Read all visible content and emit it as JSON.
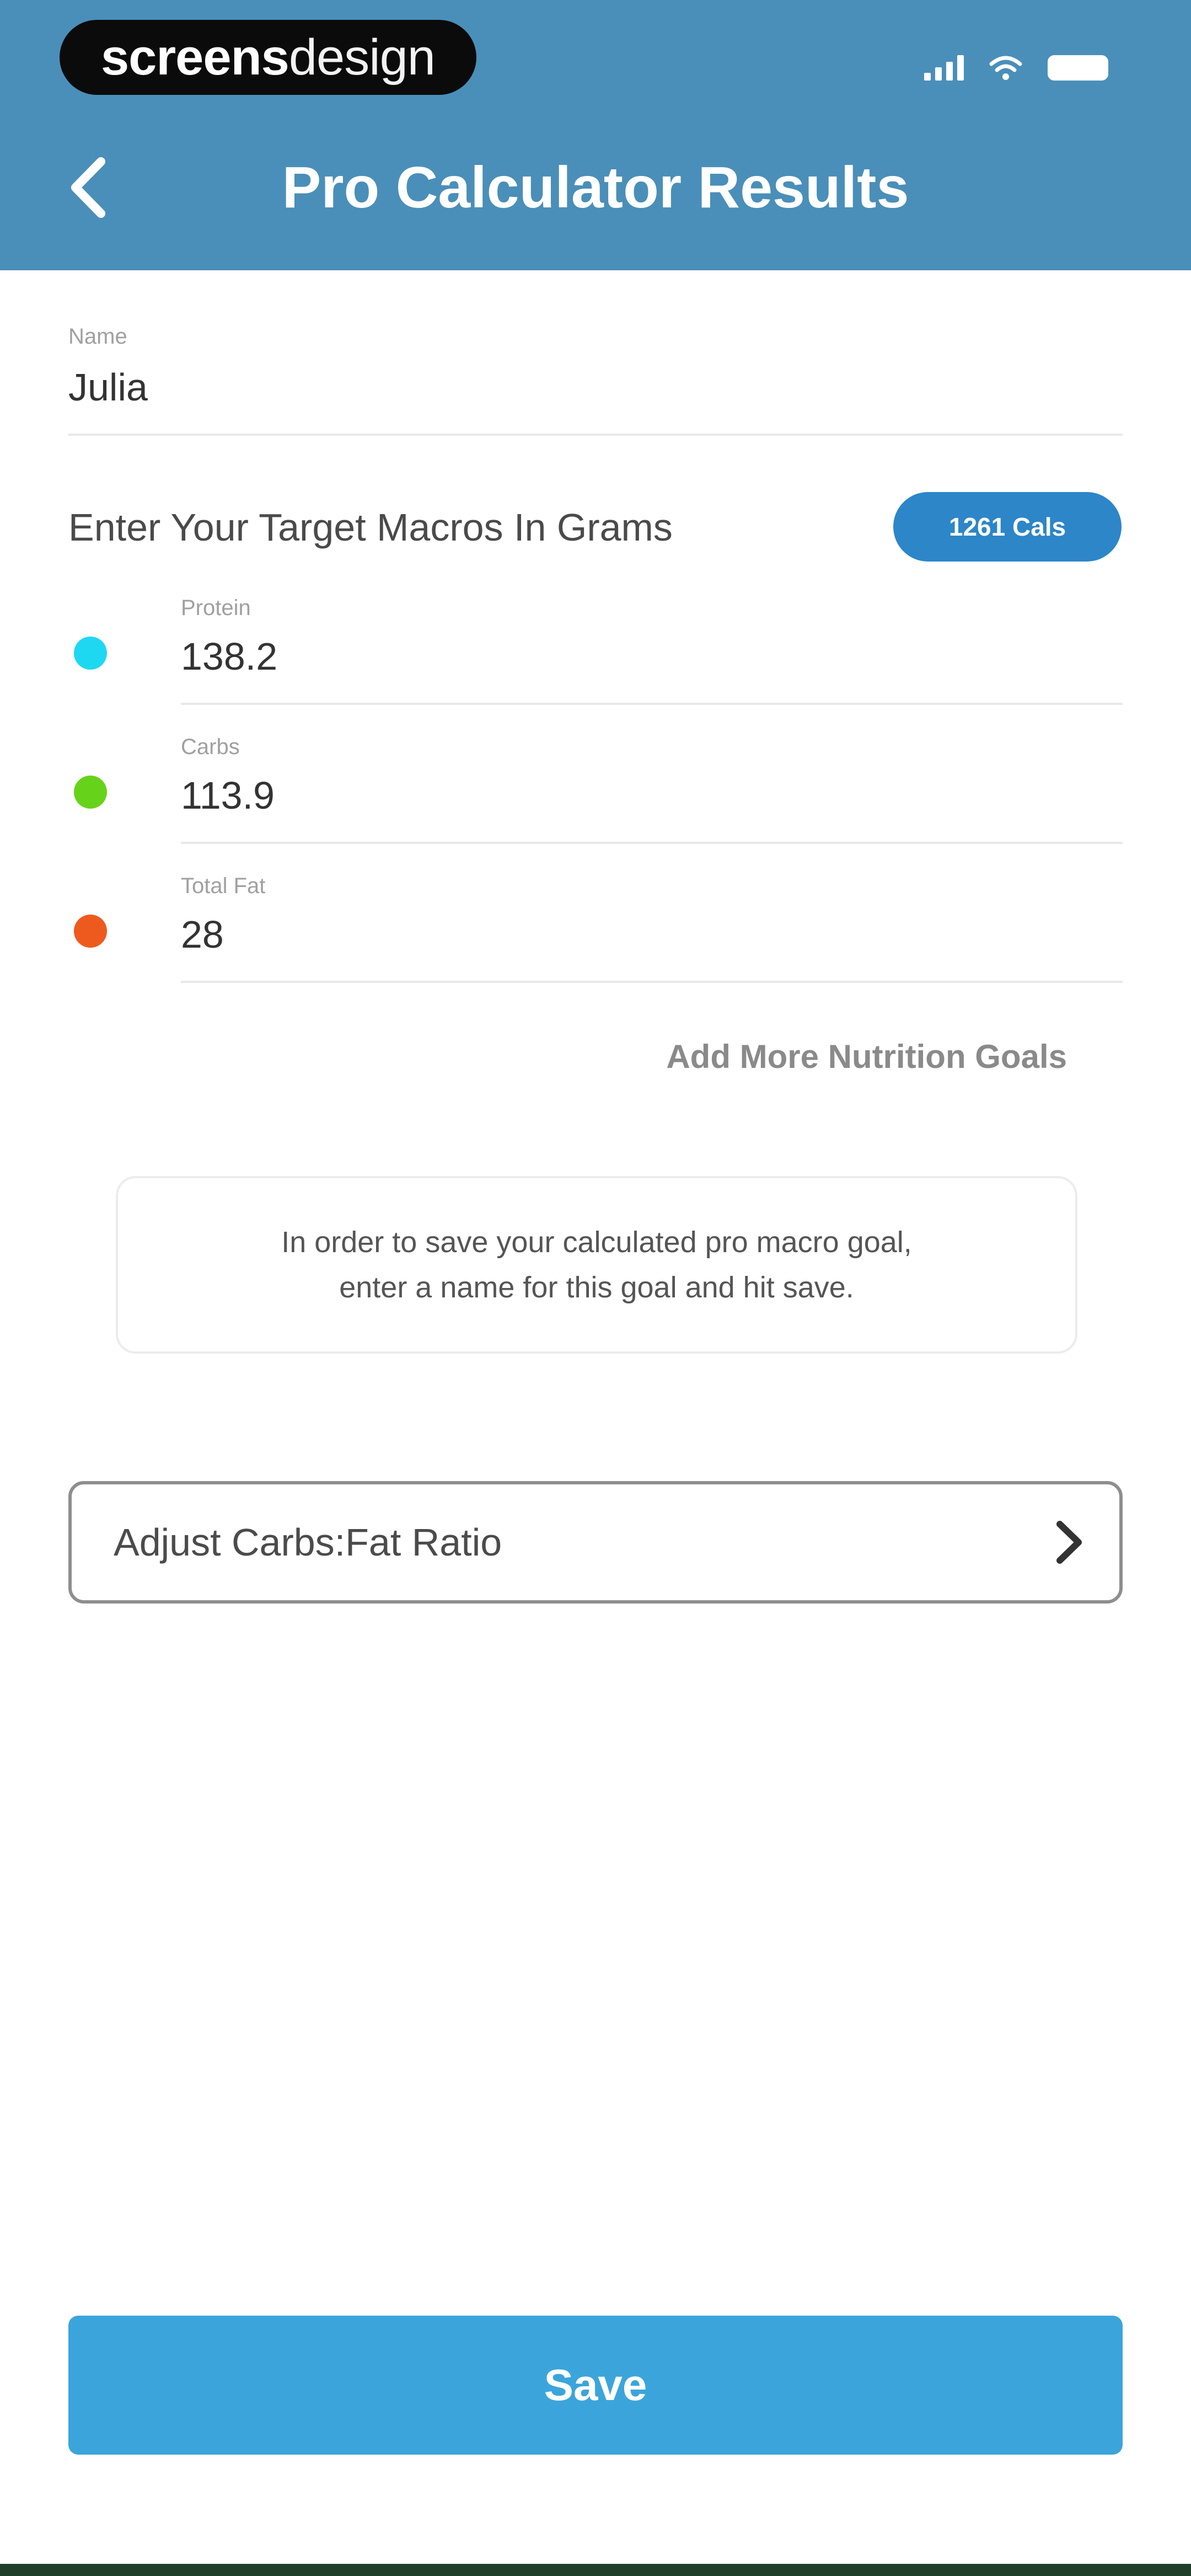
{
  "watermark": {
    "part1": "screens",
    "part2": "design"
  },
  "header": {
    "title": "Pro Calculator Results"
  },
  "name_field": {
    "label": "Name",
    "value": "Julia"
  },
  "macros": {
    "title": "Enter Your Target Macros In Grams",
    "calories_badge": "1261 Cals",
    "items": [
      {
        "label": "Protein",
        "value": "138.2",
        "color": "#1ed8f2"
      },
      {
        "label": "Carbs",
        "value": "113.9",
        "color": "#67d21a"
      },
      {
        "label": "Total Fat",
        "value": "28",
        "color": "#ee5a1d"
      }
    ]
  },
  "add_goals_link": "Add More Nutrition Goals",
  "info": {
    "line1": "In order to save your calculated pro macro goal,",
    "line2": "enter a name for this goal and hit save."
  },
  "adjust_ratio": {
    "label": "Adjust Carbs:Fat Ratio"
  },
  "save_button": {
    "label": "Save"
  },
  "colors": {
    "header": "#4a8fb9",
    "accent": "#2c86c8",
    "save": "#3ba5db"
  }
}
